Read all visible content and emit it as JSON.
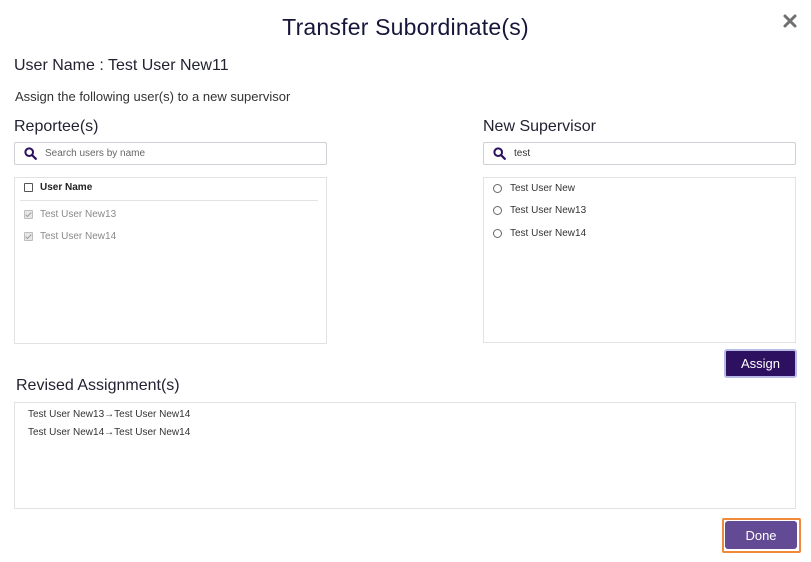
{
  "dialog": {
    "title": "Transfer Subordinate(s)",
    "user_name": "User Name : Test User New11",
    "instructions": "Assign the following user(s) to a new supervisor"
  },
  "reportees": {
    "label": "Reportee(s)",
    "search_placeholder": "Search users by name",
    "header": "User Name",
    "items": [
      {
        "label": "Test User New13",
        "checked": true,
        "disabled": true
      },
      {
        "label": "Test User New14",
        "checked": true,
        "disabled": true
      }
    ]
  },
  "supervisor": {
    "label": "New Supervisor",
    "search_value": "test",
    "items": [
      {
        "label": "Test User New"
      },
      {
        "label": "Test User New13"
      },
      {
        "label": "Test User New14"
      }
    ]
  },
  "assign_label": "Assign",
  "revised": {
    "label": "Revised Assignment(s)",
    "items": [
      "Test User New13→Test User New14",
      "Test User New14→Test User New14"
    ]
  },
  "done_label": "Done",
  "colors": {
    "assign_bg": "#2d1160",
    "done_bg": "#634a95",
    "focus_ring": "#ef8a3a",
    "search_icon": "#2d1160"
  },
  "icons": {
    "close": "close-icon",
    "search": "search-icon",
    "checkbox": "checkbox-icon",
    "radio": "radio-icon"
  }
}
